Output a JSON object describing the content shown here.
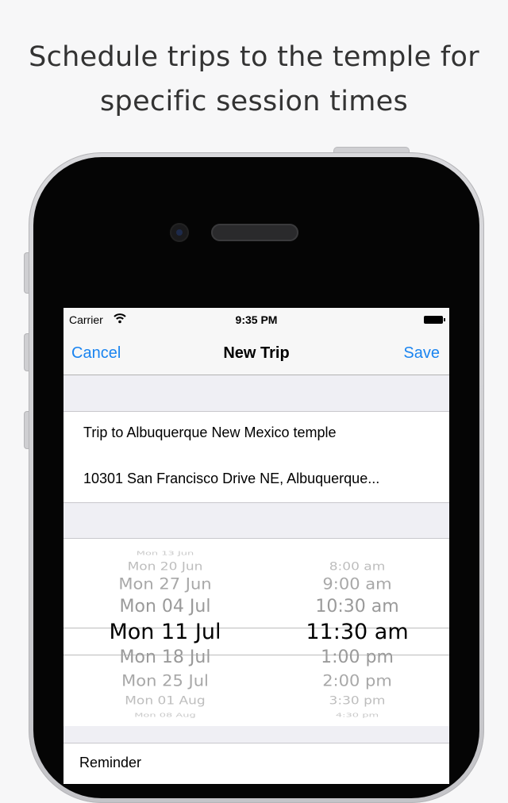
{
  "headline": {
    "line1": "Schedule trips to the temple for",
    "line2": "specific session times"
  },
  "status_bar": {
    "carrier": "Carrier",
    "time": "9:35 PM"
  },
  "nav_bar": {
    "cancel_label": "Cancel",
    "title": "New Trip",
    "save_label": "Save"
  },
  "trip_fields": {
    "name": "Trip to Albuquerque New Mexico temple",
    "address": "10301 San Francisco Drive NE, Albuquerque..."
  },
  "picker": {
    "dates": [
      "Mon 13 Jun",
      "Mon 20 Jun",
      "Mon 27 Jun",
      "Mon 04 Jul",
      "Mon 11 Jul",
      "Mon 18 Jul",
      "Mon 25 Jul",
      "Mon 01 Aug",
      "Mon 08 Aug"
    ],
    "times": [
      "",
      "8:00 am",
      "9:00 am",
      "10:30 am",
      "11:30 am",
      "1:00 pm",
      "2:00 pm",
      "3:30 pm",
      "4:30 pm"
    ],
    "selected_index": 4
  },
  "bottom_cell": {
    "label": "Reminder"
  },
  "colors": {
    "tint": "#1a84f0",
    "background": "#f7f7f8"
  }
}
